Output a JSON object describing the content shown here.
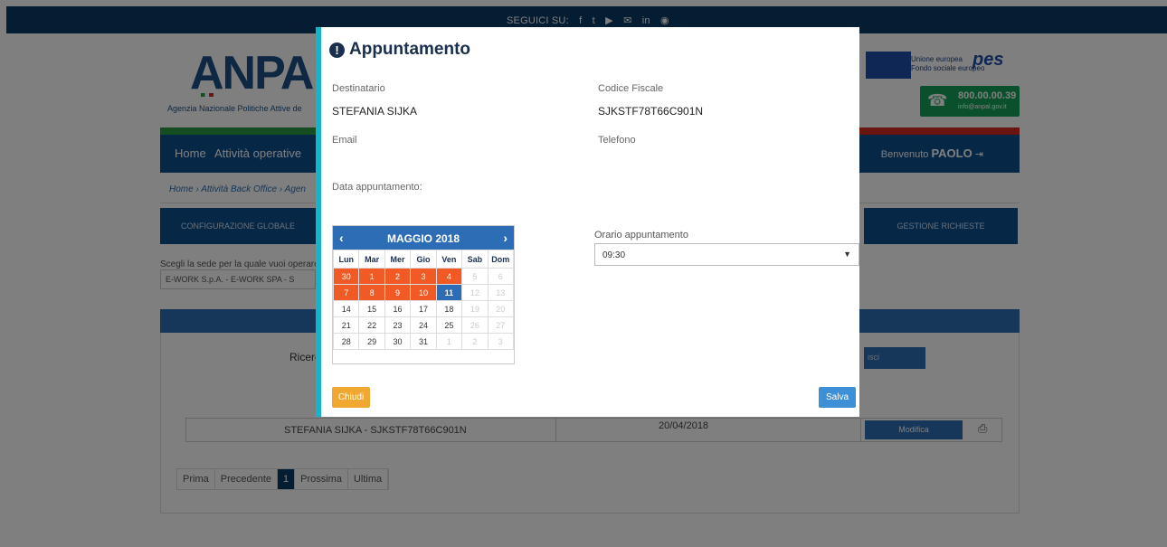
{
  "topbar": {
    "follow": "SEGUICI SU:",
    "social_icons": [
      "facebook-icon",
      "twitter-icon",
      "youtube-icon",
      "mail-icon",
      "linkedin-icon",
      "rss-icon"
    ]
  },
  "header": {
    "logo": "ANPAL",
    "agency": "Agenzia Nazionale Politiche Attive de",
    "eu_line1": "Unione europea",
    "eu_line2": "Fondo sociale europeo",
    "pes": "pes",
    "phone": "800.00.00.39",
    "email": "info@anpal.gov.it"
  },
  "nav": {
    "home": "Home",
    "attivita": "Attività operative",
    "welcome": "Benvenuto",
    "user": "PAOLO"
  },
  "breadcrumb": "Home › Attività Back Office › Agen",
  "tabs": {
    "left": "CONFIGURAZIONE GLOBALE",
    "right": "GESTIONE RICHIESTE"
  },
  "sede": {
    "label": "Scegli la sede per la quale vuoi operare",
    "value": "E-WORK S.p.A. - E-WORK SPA - S"
  },
  "search": {
    "label": "Ricerca",
    "button": "isci"
  },
  "result_row": {
    "name": "STEFANIA SIJKA - SJKSTF78T66C901N",
    "date": "20/04/2018",
    "modify": "Modifica"
  },
  "pager": [
    "Prima",
    "Precedente",
    "1",
    "Prossima",
    "Ultima"
  ],
  "modal": {
    "title": "Appuntamento",
    "destinatario_label": "Destinatario",
    "destinatario_value": "STEFANIA SIJKA",
    "cf_label": "Codice Fiscale",
    "cf_value": "SJKSTF78T66C901N",
    "email_label": "Email",
    "telefono_label": "Telefono",
    "data_label": "Data appuntamento:",
    "orario_label": "Orario appuntamento",
    "orario_value": "09:30",
    "close_button": "Chiudi",
    "save_button": "Salva"
  },
  "calendar": {
    "month_title": "MAGGIO 2018",
    "weekdays": [
      "Lun",
      "Mar",
      "Mer",
      "Gio",
      "Ven",
      "Sab",
      "Dom"
    ],
    "weeks": [
      [
        {
          "d": "30",
          "s": "red"
        },
        {
          "d": "1",
          "s": "red"
        },
        {
          "d": "2",
          "s": "red"
        },
        {
          "d": "3",
          "s": "red"
        },
        {
          "d": "4",
          "s": "red"
        },
        {
          "d": "5",
          "s": "muted"
        },
        {
          "d": "6",
          "s": "muted"
        }
      ],
      [
        {
          "d": "7",
          "s": "red"
        },
        {
          "d": "8",
          "s": "red"
        },
        {
          "d": "9",
          "s": "red"
        },
        {
          "d": "10",
          "s": "red"
        },
        {
          "d": "11",
          "s": "blue"
        },
        {
          "d": "12",
          "s": "muted"
        },
        {
          "d": "13",
          "s": "muted"
        }
      ],
      [
        {
          "d": "14",
          "s": ""
        },
        {
          "d": "15",
          "s": ""
        },
        {
          "d": "16",
          "s": ""
        },
        {
          "d": "17",
          "s": ""
        },
        {
          "d": "18",
          "s": ""
        },
        {
          "d": "19",
          "s": "muted"
        },
        {
          "d": "20",
          "s": "muted"
        }
      ],
      [
        {
          "d": "21",
          "s": ""
        },
        {
          "d": "22",
          "s": ""
        },
        {
          "d": "23",
          "s": ""
        },
        {
          "d": "24",
          "s": ""
        },
        {
          "d": "25",
          "s": ""
        },
        {
          "d": "26",
          "s": "muted"
        },
        {
          "d": "27",
          "s": "muted"
        }
      ],
      [
        {
          "d": "28",
          "s": ""
        },
        {
          "d": "29",
          "s": ""
        },
        {
          "d": "30",
          "s": ""
        },
        {
          "d": "31",
          "s": ""
        },
        {
          "d": "1",
          "s": "muted"
        },
        {
          "d": "2",
          "s": "muted"
        },
        {
          "d": "3",
          "s": "muted"
        }
      ]
    ]
  },
  "colors": {
    "accent": "#2d6db5",
    "modal_border": "#18b3c8",
    "unavailable": "#f15a24",
    "close": "#f0a830",
    "save": "#3d8fd6"
  }
}
